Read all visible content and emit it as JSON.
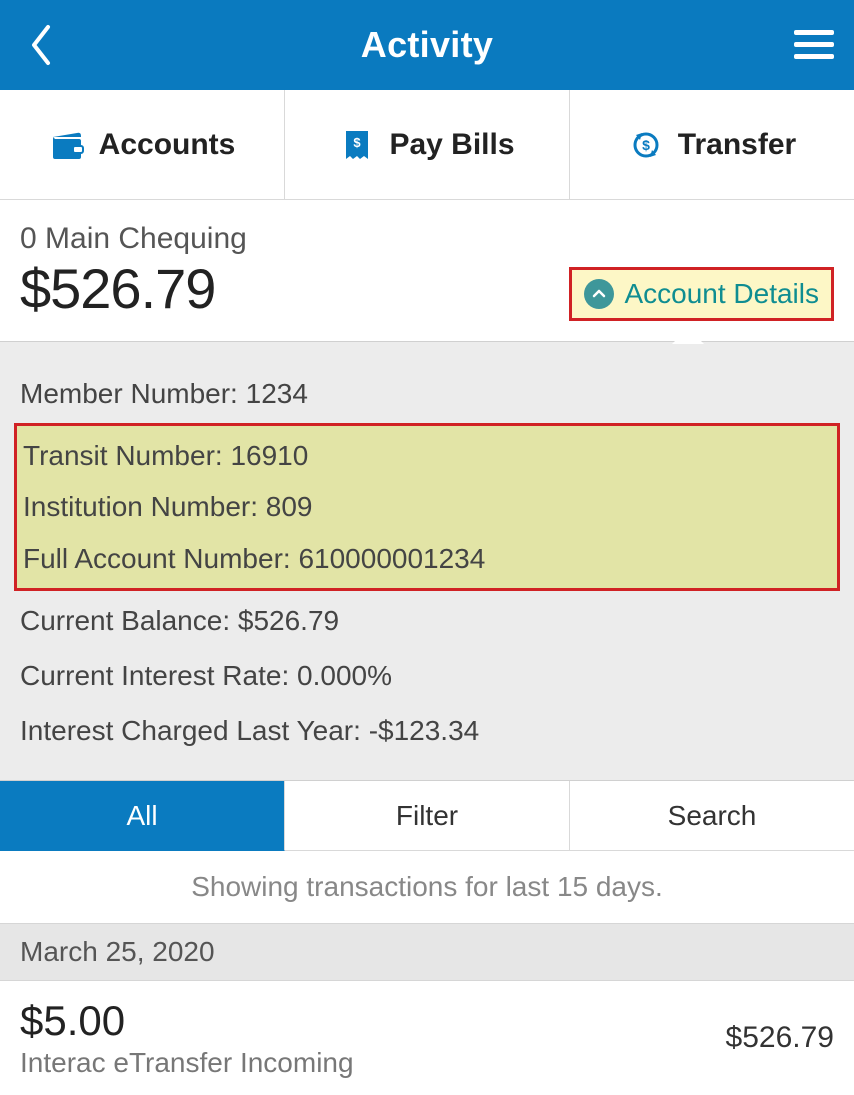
{
  "header": {
    "title": "Activity"
  },
  "top_tabs": {
    "accounts": "Accounts",
    "pay_bills": "Pay Bills",
    "transfer": "Transfer"
  },
  "account": {
    "name": "0 Main Chequing",
    "balance_display": "$526.79",
    "details_toggle_label": "Account Details"
  },
  "details": {
    "member_label": "Member Number:",
    "member_value": "1234",
    "transit_label": "Transit Number:",
    "transit_value": "16910",
    "institution_label": "Institution Number:",
    "institution_value": "809",
    "full_account_label": "Full Account Number:",
    "full_account_value": "610000001234",
    "current_balance_label": "Current Balance:",
    "current_balance_value": "$526.79",
    "interest_rate_label": "Current Interest Rate:",
    "interest_rate_value": "0.000%",
    "interest_charged_label": "Interest Charged Last Year:",
    "interest_charged_value": "-$123.34"
  },
  "sub_tabs": {
    "all": "All",
    "filter": "Filter",
    "search": "Search"
  },
  "status_text": "Showing transactions for last 15 days.",
  "transactions": {
    "date_header": "March 25, 2020",
    "row0": {
      "amount": "$5.00",
      "description": "Interac eTransfer Incoming",
      "balance": "$526.79"
    }
  }
}
